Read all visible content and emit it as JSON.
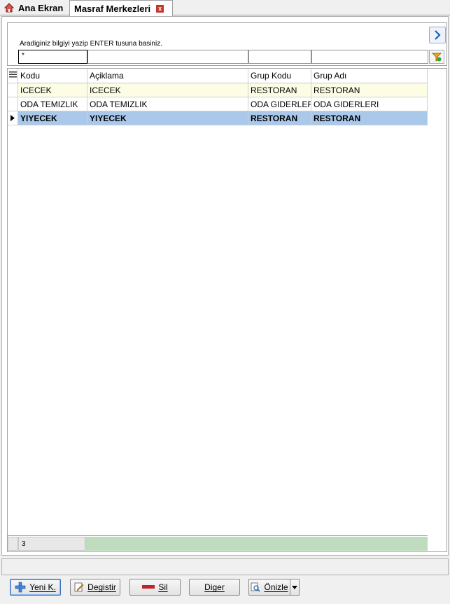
{
  "tabs": [
    {
      "label": "Ana Ekran"
    },
    {
      "label": "Masraf Merkezleri"
    }
  ],
  "search": {
    "hint": "Aradiginiz bilgiyi yazip ENTER tusuna basiniz.",
    "filter_values": [
      "*",
      "",
      "",
      ""
    ]
  },
  "grid": {
    "columns": [
      "Kodu",
      "Açiklama",
      "Grup Kodu",
      "Grup Adı"
    ],
    "rows": [
      {
        "kodu": "ICECEK",
        "aciklama": "ICECEK",
        "grup_kodu": "RESTORAN",
        "grup_adi": "RESTORAN"
      },
      {
        "kodu": "ODA TEMIZLIK",
        "aciklama": "ODA TEMIZLIK",
        "grup_kodu": "ODA GIDERLERI",
        "grup_adi": "ODA GIDERLERI"
      },
      {
        "kodu": "YIYECEK",
        "aciklama": "YIYECEK",
        "grup_kodu": "RESTORAN",
        "grup_adi": "RESTORAN"
      }
    ],
    "footer_count": "3"
  },
  "toolbar": {
    "new_label": "Yeni K.",
    "edit_label": "Degistir",
    "delete_label": "Sil",
    "other_label": "Diger",
    "preview_label": "Önizle"
  },
  "colors": {
    "selected_row": "#a9c8ea",
    "alt_row": "#fdfde6",
    "footer_bar": "#bfdcbf"
  }
}
